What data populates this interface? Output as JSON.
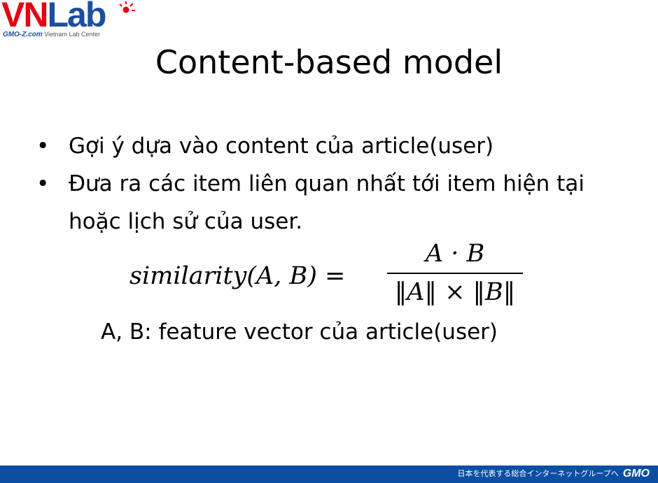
{
  "logo": {
    "vn": "VN",
    "lab": "Lab",
    "gmo": "GMO-Z.com",
    "subtitle": "Vietnam Lab Center"
  },
  "slide": {
    "title": "Content-based model",
    "bullets": [
      {
        "marker": "•",
        "text": "Gợi ý dựa vào content của article(user)"
      },
      {
        "marker": "•",
        "text": "Đưa ra các item liên quan nhất tới item hiện tại hoặc lịch sử của user."
      }
    ],
    "formula": {
      "lhs": "similarity(A, B) =",
      "numerator": "A · B",
      "denominator": "‖A‖ × ‖B‖"
    },
    "caption": "A, B: feature vector của article(user)"
  },
  "footer": {
    "tagline": "日本を代表する総合インターネットグループへ",
    "brand": "GMO"
  },
  "colors": {
    "logo_red": "#e60012",
    "logo_blue": "#1d4fa0",
    "footer_bar": "#0b4ea2"
  }
}
